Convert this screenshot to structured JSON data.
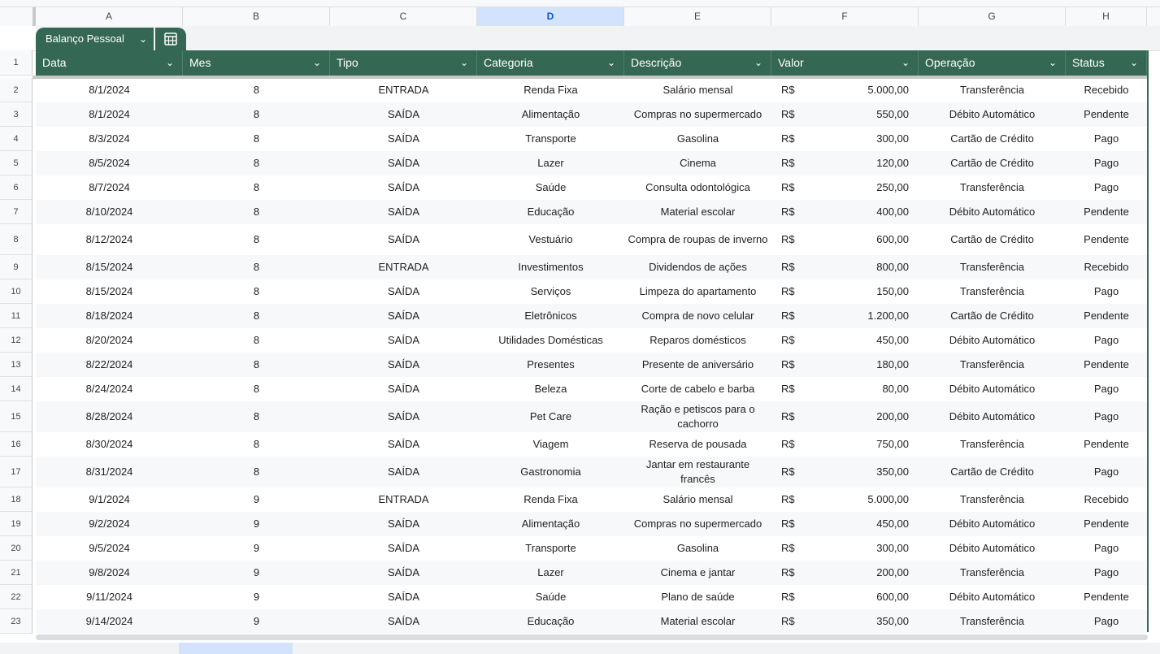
{
  "sheet": {
    "column_letters": [
      "A",
      "B",
      "C",
      "D",
      "E",
      "F",
      "G",
      "H"
    ],
    "selected_column": "D",
    "table": {
      "name": "Balanço Pessoal",
      "menu_icon": "chevron-down-icon",
      "action_icon": "table-calculator-icon",
      "header_color": "#356854"
    },
    "headers": [
      "Data",
      "Mes",
      "Tipo",
      "Categoria",
      "Descrição",
      "Valor",
      "Operação",
      "Status"
    ],
    "currency_symbol": "R$",
    "rows": [
      {
        "n": "2",
        "data": "8/1/2024",
        "mes": "8",
        "tipo": "ENTRADA",
        "categoria": "Renda Fixa",
        "descricao": "Salário mensal",
        "valor": "5.000,00",
        "operacao": "Transferência",
        "status": "Recebido"
      },
      {
        "n": "3",
        "data": "8/1/2024",
        "mes": "8",
        "tipo": "SAÍDA",
        "categoria": "Alimentação",
        "descricao": "Compras no supermercado",
        "valor": "550,00",
        "operacao": "Débito Automático",
        "status": "Pendente"
      },
      {
        "n": "4",
        "data": "8/3/2024",
        "mes": "8",
        "tipo": "SAÍDA",
        "categoria": "Transporte",
        "descricao": "Gasolina",
        "valor": "300,00",
        "operacao": "Cartão de Crédito",
        "status": "Pago"
      },
      {
        "n": "5",
        "data": "8/5/2024",
        "mes": "8",
        "tipo": "SAÍDA",
        "categoria": "Lazer",
        "descricao": "Cinema",
        "valor": "120,00",
        "operacao": "Cartão de Crédito",
        "status": "Pago"
      },
      {
        "n": "6",
        "data": "8/7/2024",
        "mes": "8",
        "tipo": "SAÍDA",
        "categoria": "Saúde",
        "descricao": "Consulta odontológica",
        "valor": "250,00",
        "operacao": "Transferência",
        "status": "Pago"
      },
      {
        "n": "7",
        "data": "8/10/2024",
        "mes": "8",
        "tipo": "SAÍDA",
        "categoria": "Educação",
        "descricao": "Material escolar",
        "valor": "400,00",
        "operacao": "Débito Automático",
        "status": "Pendente"
      },
      {
        "n": "8",
        "data": "8/12/2024",
        "mes": "8",
        "tipo": "SAÍDA",
        "categoria": "Vestuário",
        "descricao": "Compra de roupas de inverno",
        "valor": "600,00",
        "operacao": "Cartão de Crédito",
        "status": "Pendente"
      },
      {
        "n": "9",
        "data": "8/15/2024",
        "mes": "8",
        "tipo": "ENTRADA",
        "categoria": "Investimentos",
        "descricao": "Dividendos de ações",
        "valor": "800,00",
        "operacao": "Transferência",
        "status": "Recebido"
      },
      {
        "n": "10",
        "data": "8/15/2024",
        "mes": "8",
        "tipo": "SAÍDA",
        "categoria": "Serviços",
        "descricao": "Limpeza do apartamento",
        "valor": "150,00",
        "operacao": "Transferência",
        "status": "Pago"
      },
      {
        "n": "11",
        "data": "8/18/2024",
        "mes": "8",
        "tipo": "SAÍDA",
        "categoria": "Eletrônicos",
        "descricao": "Compra de novo celular",
        "valor": "1.200,00",
        "operacao": "Cartão de Crédito",
        "status": "Pendente"
      },
      {
        "n": "12",
        "data": "8/20/2024",
        "mes": "8",
        "tipo": "SAÍDA",
        "categoria": "Utilidades Domésticas",
        "descricao": "Reparos domésticos",
        "valor": "450,00",
        "operacao": "Débito Automático",
        "status": "Pago"
      },
      {
        "n": "13",
        "data": "8/22/2024",
        "mes": "8",
        "tipo": "SAÍDA",
        "categoria": "Presentes",
        "descricao": "Presente de aniversário",
        "valor": "180,00",
        "operacao": "Transferência",
        "status": "Pendente"
      },
      {
        "n": "14",
        "data": "8/24/2024",
        "mes": "8",
        "tipo": "SAÍDA",
        "categoria": "Beleza",
        "descricao": "Corte de cabelo e barba",
        "valor": "80,00",
        "operacao": "Débito Automático",
        "status": "Pago"
      },
      {
        "n": "15",
        "data": "8/28/2024",
        "mes": "8",
        "tipo": "SAÍDA",
        "categoria": "Pet Care",
        "descricao": "Ração e petiscos para o cachorro",
        "valor": "200,00",
        "operacao": "Débito Automático",
        "status": "Pago"
      },
      {
        "n": "16",
        "data": "8/30/2024",
        "mes": "8",
        "tipo": "SAÍDA",
        "categoria": "Viagem",
        "descricao": "Reserva de pousada",
        "valor": "750,00",
        "operacao": "Transferência",
        "status": "Pendente"
      },
      {
        "n": "17",
        "data": "8/31/2024",
        "mes": "8",
        "tipo": "SAÍDA",
        "categoria": "Gastronomia",
        "descricao": "Jantar em restaurante francês",
        "valor": "350,00",
        "operacao": "Cartão de Crédito",
        "status": "Pago"
      },
      {
        "n": "18",
        "data": "9/1/2024",
        "mes": "9",
        "tipo": "ENTRADA",
        "categoria": "Renda Fixa",
        "descricao": "Salário mensal",
        "valor": "5.000,00",
        "operacao": "Transferência",
        "status": "Recebido"
      },
      {
        "n": "19",
        "data": "9/2/2024",
        "mes": "9",
        "tipo": "SAÍDA",
        "categoria": "Alimentação",
        "descricao": "Compras no supermercado",
        "valor": "450,00",
        "operacao": "Débito Automático",
        "status": "Pendente"
      },
      {
        "n": "20",
        "data": "9/5/2024",
        "mes": "9",
        "tipo": "SAÍDA",
        "categoria": "Transporte",
        "descricao": "Gasolina",
        "valor": "300,00",
        "operacao": "Débito Automático",
        "status": "Pago"
      },
      {
        "n": "21",
        "data": "9/8/2024",
        "mes": "9",
        "tipo": "SAÍDA",
        "categoria": "Lazer",
        "descricao": "Cinema e jantar",
        "valor": "200,00",
        "operacao": "Transferência",
        "status": "Pago"
      },
      {
        "n": "22",
        "data": "9/11/2024",
        "mes": "9",
        "tipo": "SAÍDA",
        "categoria": "Saúde",
        "descricao": "Plano de saúde",
        "valor": "600,00",
        "operacao": "Débito Automático",
        "status": "Pendente"
      },
      {
        "n": "23",
        "data": "9/14/2024",
        "mes": "9",
        "tipo": "SAÍDA",
        "categoria": "Educação",
        "descricao": "Material escolar",
        "valor": "350,00",
        "operacao": "Transferência",
        "status": "Pago"
      }
    ]
  }
}
